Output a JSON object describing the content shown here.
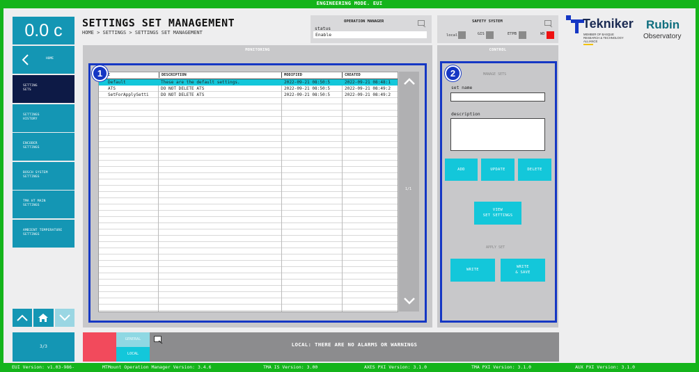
{
  "topbar": {
    "title": "ENGINEERING MODE. EUI"
  },
  "temperature": {
    "value": "0.0 c"
  },
  "sidebar": {
    "home_label": "HOME",
    "items": [
      {
        "label": "SETTING\nSETS"
      },
      {
        "label": "SETTINGS\nHISTORY"
      },
      {
        "label": "ENCODER\nSETTINGS"
      },
      {
        "label": "BOSCH SYSTEM\nSETTINGS"
      },
      {
        "label": "TMA HT MAIN\nSETTINGS"
      },
      {
        "label": "AMBIENT TEMPERATURE\nSETTINGS"
      }
    ],
    "page_counter": "3/3"
  },
  "header": {
    "title": "SETTINGS SET MANAGEMENT",
    "breadcrumb": "HOME > SETTINGS > SETTINGS SET MANAGEMENT"
  },
  "operation_manager": {
    "title": "OPERATION MANAGER",
    "status_label": "status",
    "status_value": "Enable"
  },
  "safety_system": {
    "title": "SAFETY SYSTEM",
    "indicators": [
      {
        "label": "local",
        "color": "#8a8a8a"
      },
      {
        "label": "GIS",
        "color": "#8a8a8a"
      },
      {
        "label": "ETPB",
        "color": "#8a8a8a"
      },
      {
        "label": "WD",
        "color": "#ee1111"
      }
    ]
  },
  "logos": {
    "tekniker": "Tekniker",
    "tekniker_sub": "MEMBER OF BASQUE RESEARCH & TECHNOLOGY ALLIANCE",
    "rubin": "Rubin",
    "observatory": "Observatory"
  },
  "monitoring": {
    "title": "MONITORING",
    "badge": "1",
    "columns": [
      "NAME",
      "DESCRIPTION",
      "MODIFIED",
      "CREATED"
    ],
    "rows": [
      [
        "Default",
        "These are the default settings.",
        "2022-09-21 08:50:5",
        "2022-09-21 08:48:1"
      ],
      [
        "ATS",
        "DO NOT DELETE ATS",
        "2022-09-21 08:50:5",
        "2022-09-21 08:49:2"
      ],
      [
        "SetForApplySetti",
        "DO NOT DELETE ATS",
        "2022-09-21 08:50:5",
        "2022-09-21 08:49:2"
      ]
    ],
    "selected_row": 0,
    "page_indicator": "1/1"
  },
  "control": {
    "title": "CONTROL",
    "badge": "2",
    "manage_sets_label": "MANAGE SETS",
    "set_name_label": "set name",
    "set_name_value": "",
    "description_label": "description",
    "description_value": "",
    "add_label": "ADD",
    "update_label": "UPDATE",
    "delete_label": "DELETE",
    "view_label_1": "VIEW",
    "view_label_2": "SET SETTINGS",
    "apply_set_label": "APPLY SET",
    "write_label": "WRITE",
    "write_save_1": "WRITE",
    "write_save_2": "& SAVE"
  },
  "alarms": {
    "general_label": "GENERAL",
    "local_label": "LOCAL",
    "message": "LOCAL: THERE ARE NO ALARMS OR WARNINGS"
  },
  "footer": {
    "eui_version": "EUI Version: v1.03-986-",
    "mtmount": "MTMount Operation Manager Version: 3.4.6",
    "tma_is": "TMA IS Version: 3.00",
    "axes_pxi": "AXES PXI Version: 3.1.0",
    "tma_pxi": "TMA PXI Version: 3.1.0",
    "aux_pxi": "AUX PXI Version: 3.1.0"
  },
  "colors": {
    "frame_green": "#14b41b",
    "tile_blue": "#1496b4",
    "active_navy": "#0d1a46",
    "accent_cyan": "#13c7da",
    "highlight_border": "#1537c4",
    "alarm_red": "#f24a5c",
    "wd_red": "#ee1111"
  }
}
